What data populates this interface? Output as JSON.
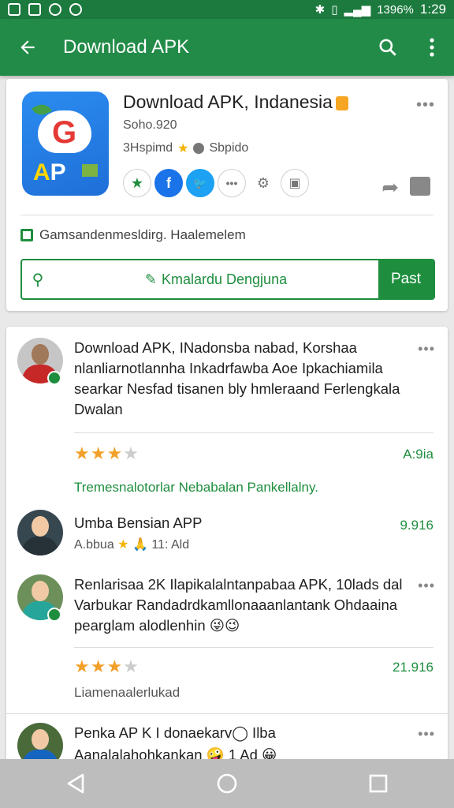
{
  "status_bar": {
    "battery": "1396%",
    "time": "1:29"
  },
  "app_bar": {
    "title": "Download APK",
    "icons": [
      "back-arrow-icon",
      "search-icon",
      "more-vert-icon"
    ]
  },
  "app_card": {
    "title": "Download APK, Indanesia",
    "meta_line1": "Soho.920",
    "meta_line2_a": "3Hspimd",
    "meta_line2_b": "Sbpido",
    "notice": "Gamsandenmesldirg. Haalemelem",
    "download_label": "Kmalardu Dengjuna",
    "primary_button": "Past",
    "action_icons": [
      "star-icon",
      "facebook-icon",
      "twitter-icon",
      "dots-icon",
      "settings-icon",
      "image-icon"
    ],
    "brand_colors": {
      "green": "#1e8e3e",
      "appbar": "#228b48"
    }
  },
  "reviews": [
    {
      "title": "Download APK, INadonsba nabad, Korshaa nlanliarnotlannha Inkadrfawba Aoe Ipkachiamila searkar Nesfad tisanen bly hmleraand Ferlengkala Dwalan",
      "rating_stars": 3,
      "score": "A:9ia",
      "footer": "Tremesnalotorlar Nebabalan Pankellalny."
    },
    {
      "title": "Umba Bensian APP",
      "subtitle": "A.bbua",
      "subtitle_tail": "11: Ald",
      "score": "9.916"
    },
    {
      "title": "Renlarisaa 2K Ilapikalalntanpabaa APK, 10lads dal Varbukar Randadrdkamllonaaanlantank Ohdaaina pearglam alodlenhin 😜😉",
      "rating_stars": 3,
      "score": "21.916",
      "footer": "Liamenaalerlukad"
    },
    {
      "title": "Penka AP K I donaekarv◯ Ilba",
      "subtitle": "Aanalalahohkankan 🤪 1 Ad 😀"
    }
  ]
}
